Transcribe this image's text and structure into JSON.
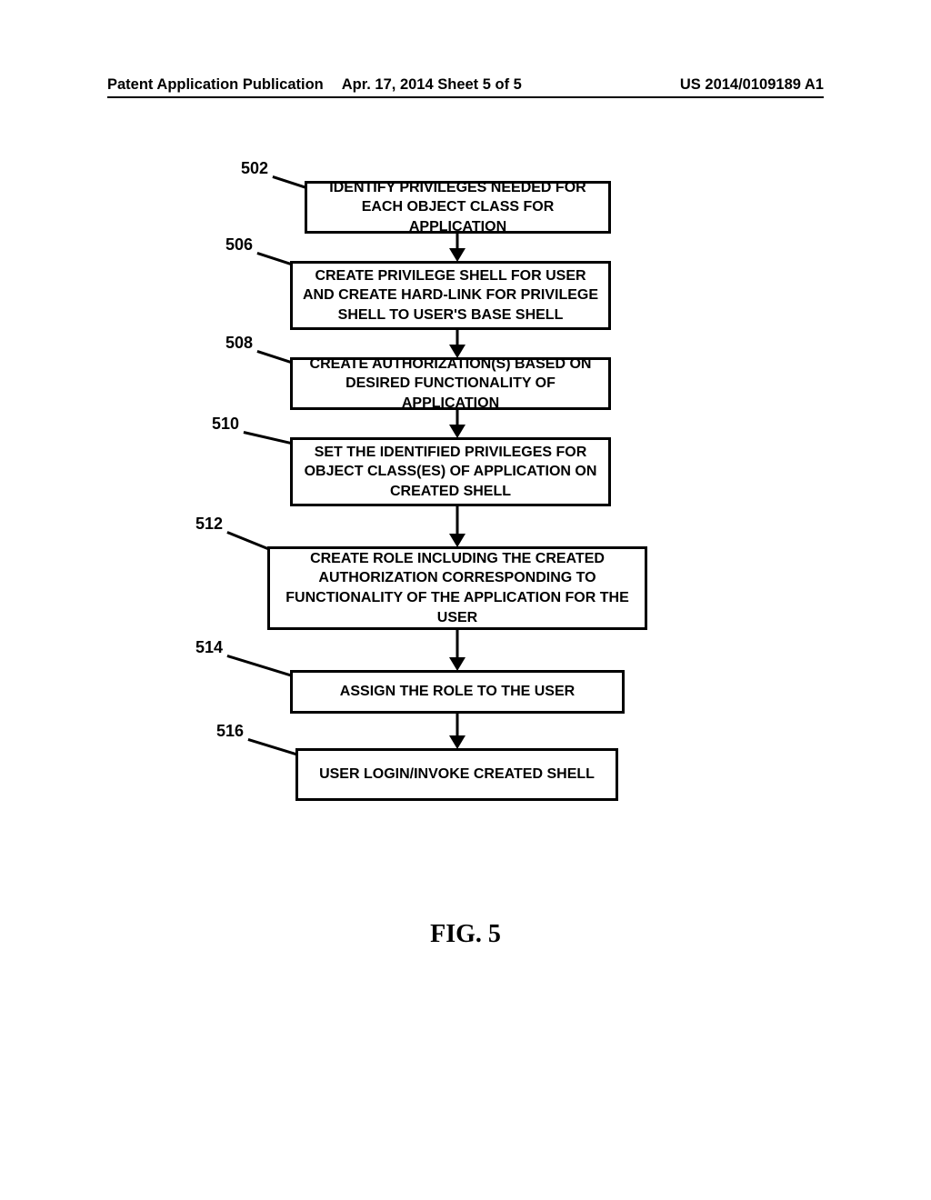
{
  "header": {
    "left": "Patent Application Publication",
    "center": "Apr. 17, 2014  Sheet 5 of 5",
    "right": "US 2014/0109189 A1"
  },
  "flowchart": {
    "steps": [
      {
        "num": "502",
        "text": "IDENTIFY PRIVILEGES NEEDED FOR EACH OBJECT CLASS FOR APPLICATION"
      },
      {
        "num": "506",
        "text": "CREATE PRIVILEGE SHELL FOR USER AND CREATE HARD-LINK FOR PRIVILEGE SHELL TO USER'S BASE SHELL"
      },
      {
        "num": "508",
        "text": "CREATE AUTHORIZATION(S) BASED ON DESIRED FUNCTIONALITY OF APPLICATION"
      },
      {
        "num": "510",
        "text": "SET THE IDENTIFIED PRIVILEGES FOR OBJECT CLASS(ES) OF APPLICATION ON CREATED SHELL"
      },
      {
        "num": "512",
        "text": "CREATE ROLE INCLUDING THE CREATED AUTHORIZATION CORRESPONDING TO FUNCTIONALITY OF THE APPLICATION FOR THE USER"
      },
      {
        "num": "514",
        "text": "ASSIGN THE ROLE TO THE USER"
      },
      {
        "num": "516",
        "text": "USER LOGIN/INVOKE CREATED SHELL"
      }
    ]
  },
  "figure_label": "FIG. 5"
}
